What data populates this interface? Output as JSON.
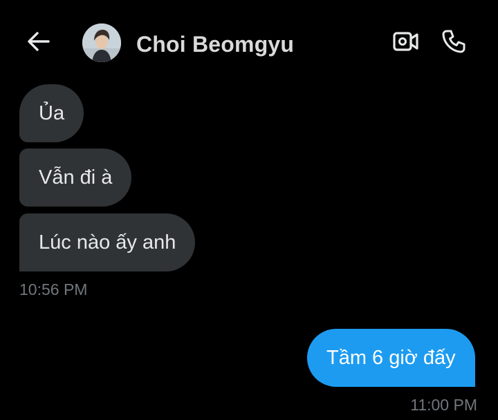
{
  "header": {
    "back_icon": "arrow-left-icon",
    "contact_name": "Choi Beomgyu",
    "video_icon": "video-camera-icon",
    "call_icon": "phone-icon"
  },
  "messages": [
    {
      "direction": "incoming",
      "text": "Ủa"
    },
    {
      "direction": "incoming",
      "text": "Vẫn đi à"
    },
    {
      "direction": "incoming",
      "text": "Lúc nào ấy anh"
    },
    {
      "direction": "outgoing",
      "text": "Tầm 6 giờ đấy"
    }
  ],
  "timestamps": {
    "incoming_group": "10:56 PM",
    "outgoing_group": "11:00 PM"
  },
  "colors": {
    "background": "#000000",
    "incoming_bubble": "#2f3336",
    "outgoing_bubble": "#1d9bf0",
    "timestamp": "#71767b"
  }
}
